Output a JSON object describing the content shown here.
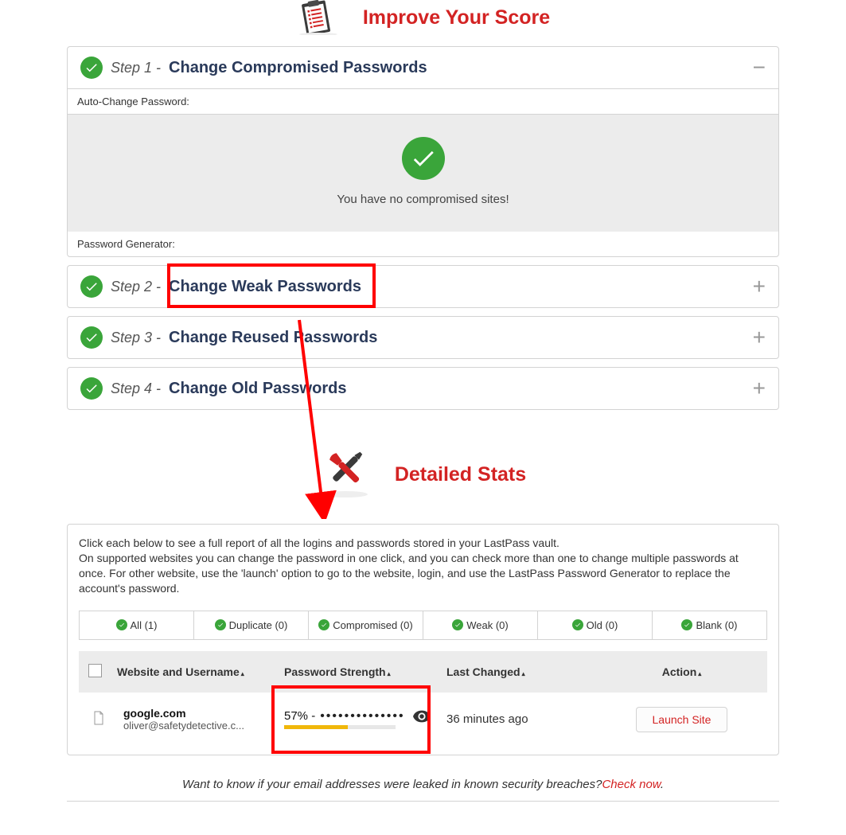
{
  "score_header": {
    "title": "Improve Your Score"
  },
  "steps": [
    {
      "num": "Step 1 -",
      "title": "Change Compromised Passwords",
      "toggle": "−",
      "sub1": "Auto-Change Password:",
      "no_msg": "You have no compromised sites!",
      "sub2": "Password Generator:"
    },
    {
      "num": "Step 2 -",
      "title": "Change Weak Passwords",
      "toggle": "+"
    },
    {
      "num": "Step 3 -",
      "title": "Change Reused Passwords",
      "toggle": "+"
    },
    {
      "num": "Step 4 -",
      "title": "Change Old Passwords",
      "toggle": "+"
    }
  ],
  "stats": {
    "title": "Detailed Stats",
    "intro": "Click each below to see a full report of all the logins and passwords stored in your LastPass vault.\nOn supported websites you can change the password in one click, and you can check more than one to change multiple passwords at once. For other website, use the 'launch' option to go to the website, login, and use the LastPass Password Generator to replace the account's password.",
    "tabs": [
      "All (1)",
      "Duplicate (0)",
      "Compromised (0)",
      "Weak (0)",
      "Old (0)",
      "Blank (0)"
    ],
    "columns": {
      "site": "Website and Username",
      "strength": "Password Strength",
      "changed": "Last Changed",
      "action": "Action"
    },
    "rows": [
      {
        "site": "google.com",
        "user": "oliver@safetydetective.c...",
        "pct": "57% -",
        "dots": "••••••••••••••",
        "bar_pct": 57,
        "changed": "36 minutes ago",
        "action": "Launch Site"
      }
    ]
  },
  "breach": {
    "q": "Want to know if your email addresses were leaked in known security breaches?",
    "link": "Check now",
    "end": "."
  }
}
